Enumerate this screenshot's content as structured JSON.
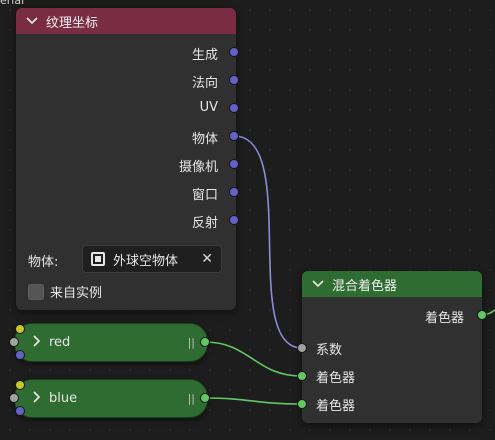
{
  "top_label": "erial",
  "texture_coord_node": {
    "title": "纹理坐标",
    "outputs": [
      "生成",
      "法向",
      "UV",
      "物体",
      "摄像机",
      "窗口",
      "反射"
    ],
    "object_label": "物体:",
    "object_value": "外球空物体",
    "from_instancer_label": "来自实例",
    "header_color": "#7a2c45"
  },
  "mix_shader_node": {
    "title": "混合着色器",
    "output_label": "着色器",
    "inputs": [
      "系数",
      "着色器",
      "着色器"
    ],
    "header_color": "#2f6c31"
  },
  "group_nodes": [
    {
      "label": "red"
    },
    {
      "label": "blue"
    }
  ]
}
